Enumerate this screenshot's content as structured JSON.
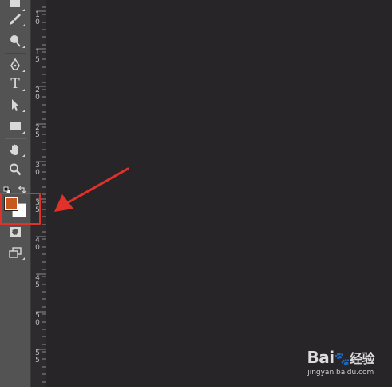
{
  "toolbar": {
    "tools": [
      {
        "name": "eraser-tool-icon"
      },
      {
        "name": "brush-tool-icon"
      },
      {
        "name": "dodge-tool-icon"
      },
      {
        "name": "pen-tool-icon"
      },
      {
        "name": "type-tool-icon",
        "glyph": "T"
      },
      {
        "name": "path-selection-tool-icon"
      },
      {
        "name": "rectangle-tool-icon"
      },
      {
        "name": "hand-tool-icon"
      },
      {
        "name": "zoom-tool-icon"
      }
    ],
    "colors": {
      "foreground": "#c9581c",
      "background": "#ffffff"
    }
  },
  "ruler": {
    "labels": [
      "1\n0",
      "1\n5",
      "2\n0",
      "2\n5",
      "3\n0",
      "3\n5",
      "4\n0",
      "4\n5",
      "5\n0",
      "5\n5"
    ]
  },
  "annotation": {
    "box_color": "#e0312b",
    "arrow_color": "#e0312b"
  },
  "watermark": {
    "logo_text": "Bai",
    "logo_suffix": "经验",
    "url": "jingyan.baidu.com"
  }
}
